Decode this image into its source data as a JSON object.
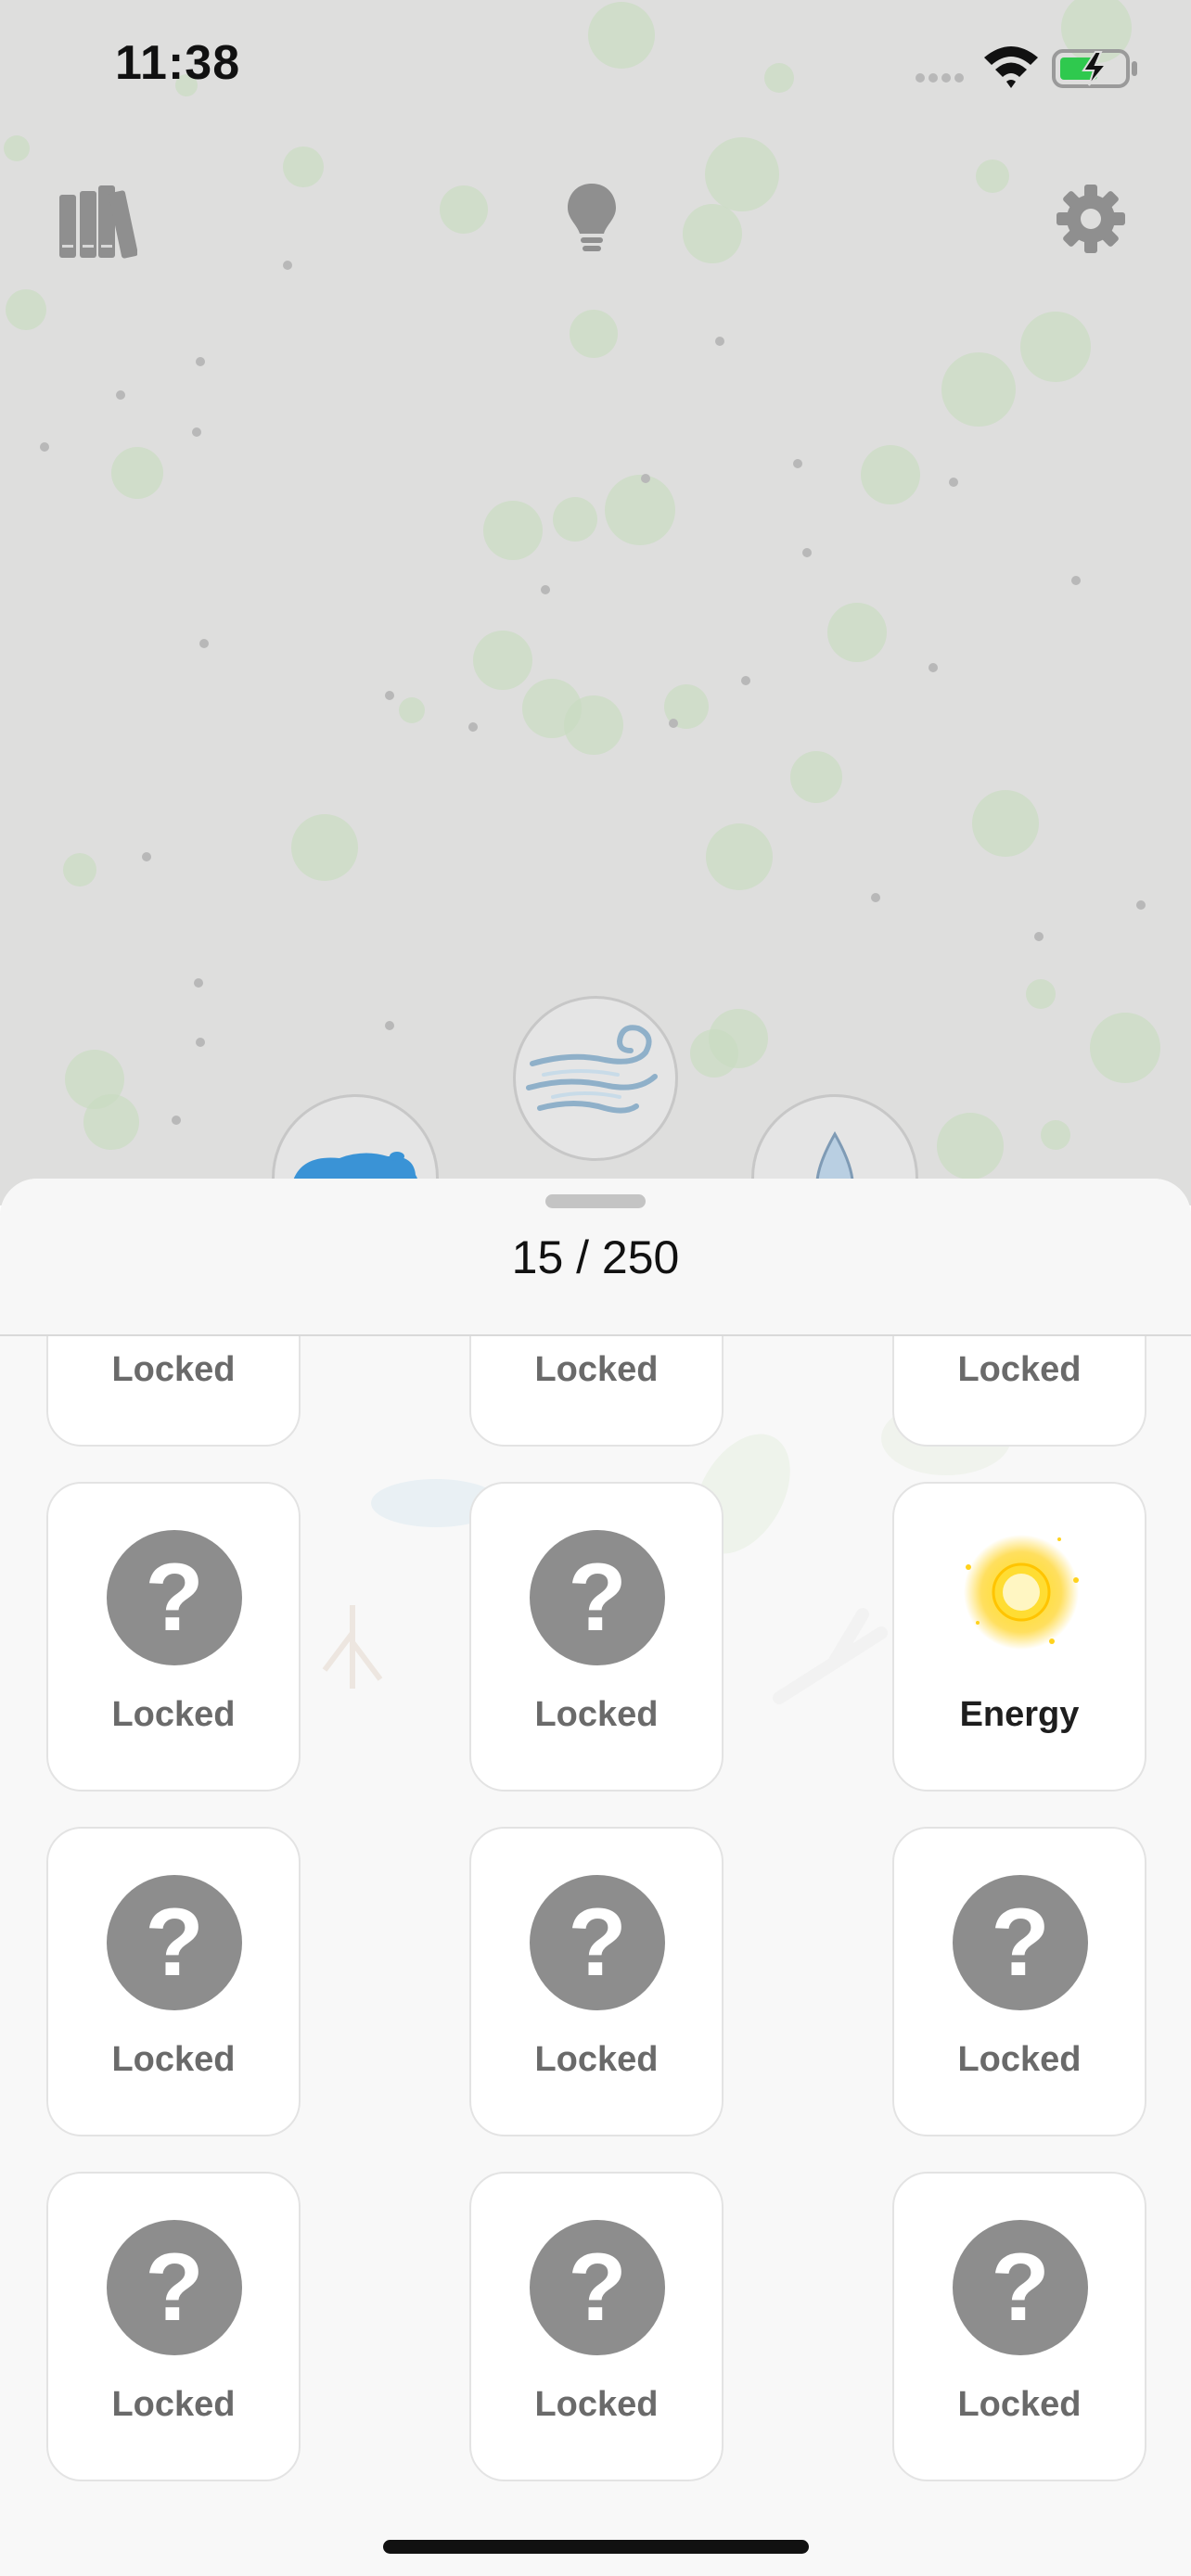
{
  "status_bar": {
    "time": "11:38",
    "icons": [
      "signal-dots-icon",
      "wifi-icon",
      "battery-charging-icon"
    ],
    "battery_color": "#2fc94e"
  },
  "toolbar": {
    "icons": [
      "library-icon",
      "lightbulb-hint-icon",
      "gear-settings-icon"
    ]
  },
  "board": {
    "elements": [
      "wind-element",
      "water-puddle-element",
      "water-drop-element"
    ]
  },
  "sheet": {
    "counter": "15 / 250"
  },
  "grid": {
    "cards": [
      {
        "label": "Locked",
        "icon": "question-icon",
        "unlocked": false
      },
      {
        "label": "Locked",
        "icon": "question-icon",
        "unlocked": false
      },
      {
        "label": "Locked",
        "icon": "question-icon",
        "unlocked": false
      },
      {
        "label": "Locked",
        "icon": "question-icon",
        "unlocked": false
      },
      {
        "label": "Locked",
        "icon": "question-icon",
        "unlocked": false
      },
      {
        "label": "Energy",
        "icon": "sun-icon",
        "unlocked": true
      },
      {
        "label": "Locked",
        "icon": "question-icon",
        "unlocked": false
      },
      {
        "label": "Locked",
        "icon": "question-icon",
        "unlocked": false
      },
      {
        "label": "Locked",
        "icon": "question-icon",
        "unlocked": false
      },
      {
        "label": "Locked",
        "icon": "question-icon",
        "unlocked": false
      },
      {
        "label": "Locked",
        "icon": "question-icon",
        "unlocked": false
      },
      {
        "label": "Locked",
        "icon": "question-icon",
        "unlocked": false
      }
    ],
    "locked_glyph": "?"
  },
  "colors": {
    "board_background": "#dededd",
    "bubble": "#c8dcc0",
    "locked_circle": "#8d8d8d",
    "sun": "#ffd21c"
  }
}
